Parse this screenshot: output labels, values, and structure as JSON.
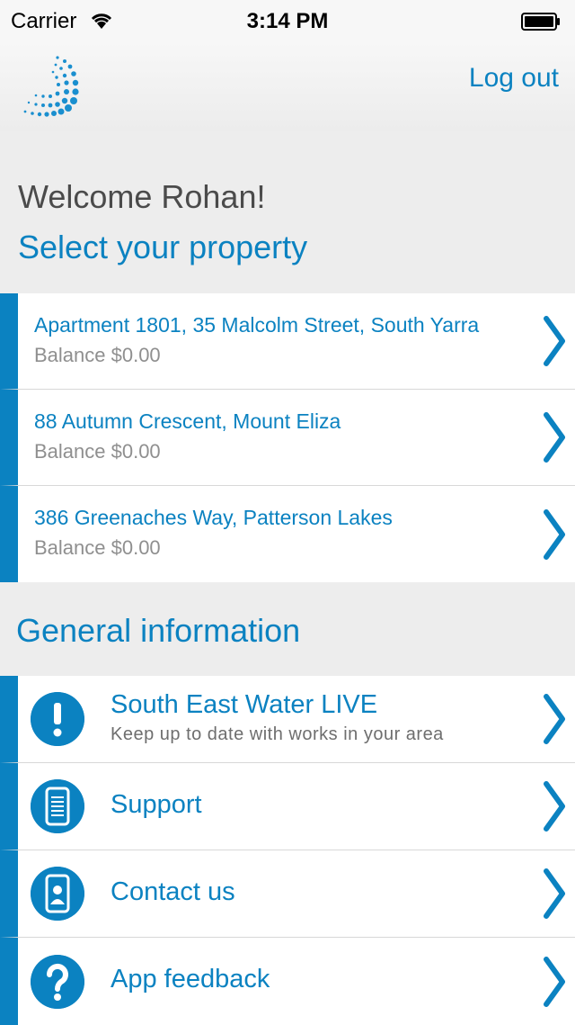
{
  "status_bar": {
    "carrier": "Carrier",
    "time": "3:14 PM"
  },
  "nav": {
    "logout_label": "Log out",
    "logo_icon": "dotted-spiral-logo"
  },
  "welcome_text": "Welcome Rohan!",
  "select_title": "Select your property",
  "properties": [
    {
      "address": "Apartment 1801, 35 Malcolm Street, South Yarra",
      "balance": "Balance $0.00"
    },
    {
      "address": "88 Autumn Crescent, Mount Eliza",
      "balance": "Balance $0.00"
    },
    {
      "address": "386 Greenaches Way, Patterson Lakes",
      "balance": "Balance $0.00"
    }
  ],
  "general_title": "General information",
  "info_items": [
    {
      "label": "South East Water LIVE",
      "sublabel": "Keep up to date with works in your area",
      "icon": "exclamation-icon"
    },
    {
      "label": "Support",
      "icon": "document-phone-icon"
    },
    {
      "label": "Contact us",
      "icon": "contact-phone-icon"
    },
    {
      "label": "App feedback",
      "icon": "question-icon"
    }
  ],
  "colors": {
    "accent": "#0b82c1",
    "background": "#ededed",
    "welcome_text": "#4b4b4b"
  }
}
